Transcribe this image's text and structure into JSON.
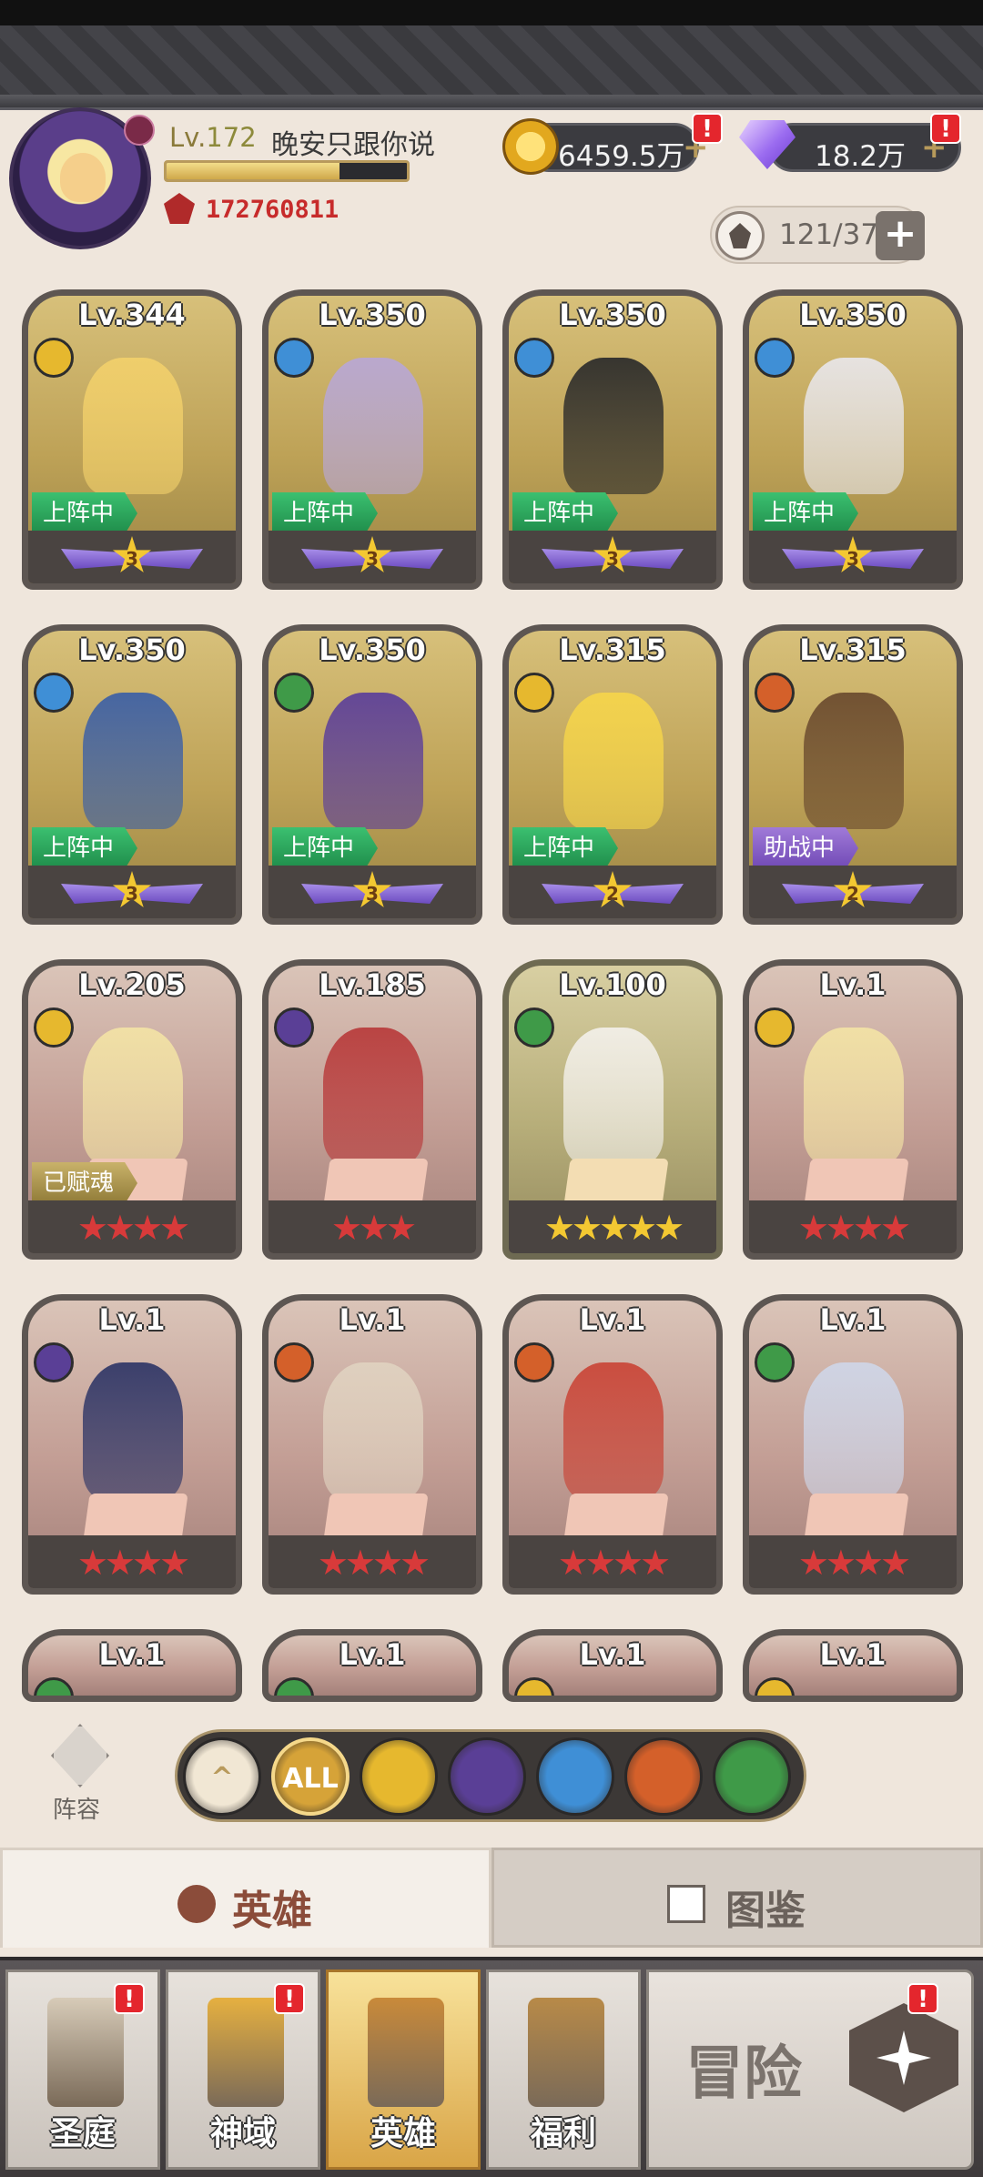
{
  "player": {
    "level_prefix": "Lv.",
    "level": "172",
    "name": "晚安只跟你说",
    "exp_fraction": 0.72,
    "power": "172760811"
  },
  "resources": {
    "gold": "6459.5万",
    "diamond": "18.2万",
    "alert_mark": "!"
  },
  "capacity": {
    "value": "121/375",
    "plus": "+"
  },
  "heroes": [
    {
      "level": "Lv.344",
      "rarity": "gold",
      "faction": "light",
      "status": "上阵中",
      "status_type": "onteam",
      "star": "3"
    },
    {
      "level": "Lv.350",
      "rarity": "gold",
      "faction": "sky",
      "status": "上阵中",
      "status_type": "onteam",
      "star": "3"
    },
    {
      "level": "Lv.350",
      "rarity": "gold",
      "faction": "sky",
      "status": "上阵中",
      "status_type": "onteam",
      "star": "3"
    },
    {
      "level": "Lv.350",
      "rarity": "gold",
      "faction": "sky",
      "status": "上阵中",
      "status_type": "onteam",
      "star": "3"
    },
    {
      "level": "Lv.350",
      "rarity": "gold",
      "faction": "sky",
      "status": "上阵中",
      "status_type": "onteam",
      "star": "3"
    },
    {
      "level": "Lv.350",
      "rarity": "gold",
      "faction": "forest",
      "status": "上阵中",
      "status_type": "onteam",
      "star": "3"
    },
    {
      "level": "Lv.315",
      "rarity": "gold",
      "faction": "light",
      "status": "上阵中",
      "status_type": "onteam",
      "star": "2"
    },
    {
      "level": "Lv.315",
      "rarity": "gold",
      "faction": "beast",
      "status": "助战中",
      "status_type": "assist",
      "star": "2"
    },
    {
      "level": "Lv.205",
      "rarity": "red",
      "faction": "light",
      "status": "已赋魂",
      "status_type": "soul",
      "stars": "★★★★",
      "star_color": "red"
    },
    {
      "level": "Lv.185",
      "rarity": "red",
      "faction": "dark",
      "status": "",
      "status_type": "",
      "stars": "★★★",
      "star_color": "red"
    },
    {
      "level": "Lv.100",
      "rarity": "green",
      "faction": "forest",
      "status": "",
      "status_type": "",
      "stars": "★★★★★",
      "star_color": "gold"
    },
    {
      "level": "Lv.1",
      "rarity": "red",
      "faction": "light",
      "status": "",
      "status_type": "",
      "stars": "★★★★",
      "star_color": "red"
    },
    {
      "level": "Lv.1",
      "rarity": "red",
      "faction": "dark",
      "status": "",
      "status_type": "",
      "stars": "★★★★",
      "star_color": "red"
    },
    {
      "level": "Lv.1",
      "rarity": "red",
      "faction": "beast",
      "status": "",
      "status_type": "",
      "stars": "★★★★",
      "star_color": "red"
    },
    {
      "level": "Lv.1",
      "rarity": "red",
      "faction": "beast",
      "status": "",
      "status_type": "",
      "stars": "★★★★",
      "star_color": "red"
    },
    {
      "level": "Lv.1",
      "rarity": "red",
      "faction": "forest",
      "status": "",
      "status_type": "",
      "stars": "★★★★",
      "star_color": "red"
    },
    {
      "level": "Lv.1",
      "rarity": "red",
      "faction": "forest",
      "status": "",
      "status_type": "",
      "stars": "",
      "star_color": "red"
    },
    {
      "level": "Lv.1",
      "rarity": "red",
      "faction": "forest",
      "status": "",
      "status_type": "",
      "stars": "",
      "star_color": "red"
    },
    {
      "level": "Lv.1",
      "rarity": "red",
      "faction": "light",
      "status": "",
      "status_type": "",
      "stars": "",
      "star_color": "red"
    },
    {
      "level": "Lv.1",
      "rarity": "red",
      "faction": "light",
      "status": "",
      "status_type": "",
      "stars": "",
      "star_color": "red"
    }
  ],
  "faction_colors": {
    "light": "#e6b82e",
    "sky": "#3f8fd6",
    "forest": "#3f9a48",
    "beast": "#d4602a",
    "dark": "#5a3f96"
  },
  "lineup": {
    "label": "阵容"
  },
  "filters": [
    {
      "key": "up",
      "label": "^",
      "icon": "chevron-up-icon",
      "color": "#f1e7d4"
    },
    {
      "key": "all",
      "label": "ALL",
      "icon": "all-icon",
      "color": "#d6a338",
      "active": true
    },
    {
      "key": "light",
      "label": "",
      "icon": "light-faction-icon",
      "color": "#e6b82e"
    },
    {
      "key": "dark",
      "label": "",
      "icon": "dark-faction-icon",
      "color": "#5a3f96"
    },
    {
      "key": "sky",
      "label": "",
      "icon": "sky-faction-icon",
      "color": "#3f8fd6"
    },
    {
      "key": "beast",
      "label": "",
      "icon": "beast-faction-icon",
      "color": "#d4602a"
    },
    {
      "key": "forest",
      "label": "",
      "icon": "forest-faction-icon",
      "color": "#3f9a48"
    }
  ],
  "tabs": {
    "heroes": "英雄",
    "codex": "图鉴"
  },
  "nav": [
    {
      "label": "圣庭",
      "alert": true,
      "active": false
    },
    {
      "label": "神域",
      "alert": true,
      "active": false
    },
    {
      "label": "英雄",
      "alert": false,
      "active": true
    },
    {
      "label": "福利",
      "alert": false,
      "active": false
    }
  ],
  "adventure": {
    "label": "冒险",
    "alert": true
  }
}
